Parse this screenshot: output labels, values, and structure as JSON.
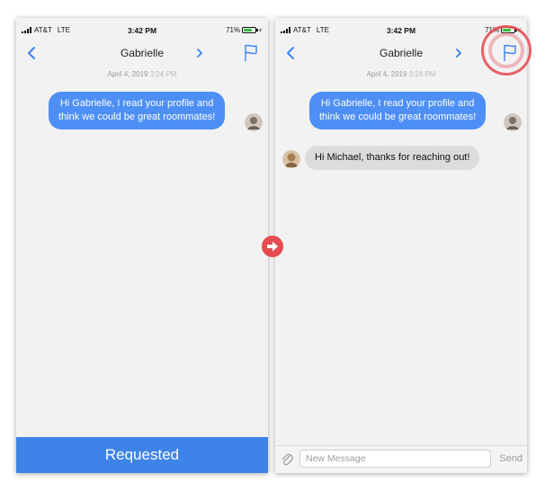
{
  "status_bar": {
    "carrier": "AT&T",
    "network": "LTE",
    "time": "3:42 PM",
    "battery": "71%",
    "battery_level": 0.71
  },
  "colors": {
    "accent": "#4d8ff5",
    "button_blue": "#3e84e8",
    "annotation_red": "#e64b4f"
  },
  "left_screen": {
    "nav": {
      "title": "Gabrielle"
    },
    "date": "April 4, 2019",
    "date_time": "3:24 PM",
    "messages": [
      {
        "direction": "outgoing",
        "line1": "Hi Gabrielle, I read your profile and",
        "line2": "think we could be great roommates!"
      }
    ],
    "bottom_button": "Requested"
  },
  "right_screen": {
    "nav": {
      "title": "Gabrielle"
    },
    "date": "April 4, 2019",
    "date_time": "3:24 PM",
    "messages": [
      {
        "direction": "outgoing",
        "line1": "Hi Gabrielle, I read your profile and",
        "line2": "think we could be great roommates!"
      },
      {
        "direction": "incoming",
        "text": "Hi Michael, thanks for reaching out!"
      }
    ],
    "composer": {
      "placeholder": "New Message",
      "value": "",
      "send_label": "Send"
    }
  },
  "icons": {
    "back": "chevron-left-icon",
    "profile": "chevron-right-icon",
    "report": "flag-icon",
    "attach": "paperclip-icon",
    "transition": "arrow-right-icon"
  }
}
